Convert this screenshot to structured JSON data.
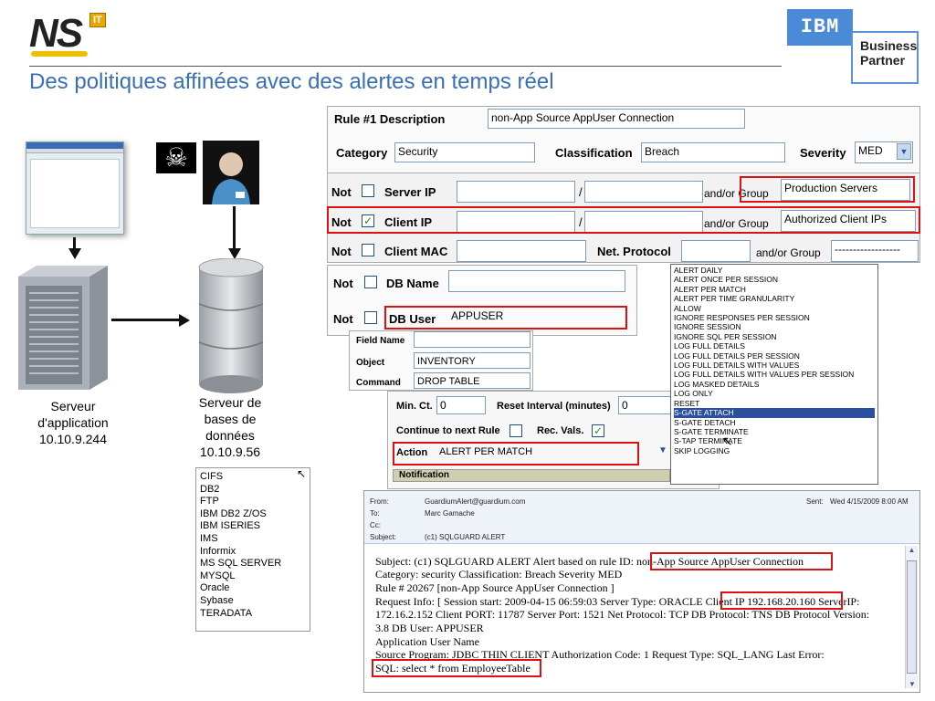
{
  "header": {
    "logo_text": "NS",
    "logo_badge": "IT",
    "title": "Des politiques affinées avec des alertes en temps réel",
    "partner_brand": "IBM",
    "partner_line1": "Business",
    "partner_line2": "Partner"
  },
  "diagram": {
    "app_server_caption": [
      "Serveur",
      "d'application",
      "10.10.9.244"
    ],
    "db_server_caption": [
      "Serveur de",
      "bases de",
      "données",
      "10.10.9.56"
    ],
    "db_types": [
      "CIFS",
      "DB2",
      "FTP",
      "IBM DB2 Z/OS",
      "IBM ISERIES",
      "IMS",
      "Informix",
      "MS SQL SERVER",
      "MYSQL",
      "Oracle",
      "Sybase",
      "TERADATA"
    ]
  },
  "rule": {
    "desc_label": "Rule #1 Description",
    "desc_value": "non-App Source AppUser Connection",
    "category_label": "Category",
    "category_value": "Security",
    "classification_label": "Classification",
    "classification_value": "Breach",
    "severity_label": "Severity",
    "severity_value": "MED",
    "not_label": "Not",
    "slash": "/",
    "andor_group_label": "and/or Group",
    "server_ip_label": "Server IP",
    "server_group_value": "Production Servers",
    "client_ip_label": "Client IP",
    "client_group_value": "Authorized Client IPs",
    "client_mac_label": "Client MAC",
    "net_protocol_label": "Net. Protocol",
    "mac_group_value": "------------------",
    "db_name_label": "DB Name",
    "db_user_label": "DB User",
    "db_user_value": "APPUSER",
    "field_name_label": "Field Name",
    "object_label": "Object",
    "object_value": "INVENTORY",
    "command_label": "Command",
    "command_value": "DROP TABLE",
    "min_ct_label": "Min. Ct.",
    "min_ct_value": "0",
    "reset_interval_label": "Reset Interval (minutes)",
    "reset_interval_value": "0",
    "continue_label": "Continue to next Rule",
    "rec_vals_label": "Rec. Vals.",
    "action_label": "Action",
    "action_value": "ALERT PER MATCH",
    "notification_label": "Notification"
  },
  "action_dropdown": {
    "options": [
      "ALERT DAILY",
      "ALERT ONCE PER SESSION",
      "ALERT PER MATCH",
      "ALERT PER TIME GRANULARITY",
      "ALLOW",
      "IGNORE RESPONSES PER SESSION",
      "IGNORE SESSION",
      "IGNORE SQL PER SESSION",
      "LOG FULL DETAILS",
      "LOG FULL DETAILS PER SESSION",
      "LOG FULL DETAILS WITH VALUES",
      "LOG FULL DETAILS WITH VALUES PER SESSION",
      "LOG MASKED DETAILS",
      "LOG ONLY",
      "RESET",
      "S-GATE ATTACH",
      "S-GATE DETACH",
      "S-GATE TERMINATE",
      "S-TAP TERMINATE",
      "SKIP LOGGING"
    ],
    "selected": "S-GATE ATTACH"
  },
  "email": {
    "from_label": "From:",
    "from_value": "GuardiumAlert@guardium.com",
    "to_label": "To:",
    "to_value": "Marc Gamache",
    "cc_label": "Cc:",
    "subject_label": "Subject:",
    "subject_value": "(c1) SQLGUARD ALERT",
    "sent_label": "Sent:",
    "sent_value": "Wed 4/15/2009 8:00 AM",
    "lines": [
      "Subject: (c1) SQLGUARD ALERT Alert based on rule ID: non-App Source AppUser Connection",
      "Category: security Classification: Breach Severity MED",
      "Rule # 20267 [non-App Source AppUser Connection ]",
      "Request Info: [ Session start: 2009-04-15 06:59:03 Server Type: ORACLE Client IP 192.168.20.160 ServerIP:",
      "172.16.2.152 Client PORT: 11787 Server Port: 1521 Net Protocol: TCP DB Protocol: TNS DB Protocol Version:",
      "3.8 DB User: APPUSER",
      "Application User Name",
      "Source Program: JDBC THIN CLIENT Authorization Code: 1 Request Type: SQL_LANG Last Error:",
      "SQL: select * from EmployeeTable"
    ]
  },
  "colors": {
    "title_blue": "#3a6fb7",
    "highlight_red": "#dd1111",
    "selection_blue": "#2b4f9e"
  }
}
